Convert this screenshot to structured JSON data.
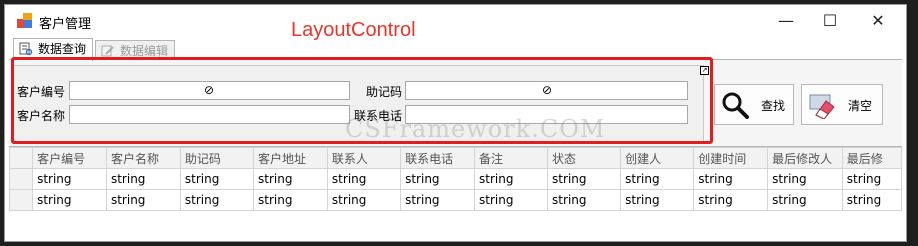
{
  "window": {
    "title": "客户管理",
    "minimize_glyph": "—",
    "maximize_glyph": "☐",
    "close_glyph": "✕"
  },
  "overlay_label": "LayoutControl",
  "tabs": [
    {
      "label": "数据查询",
      "active": true,
      "icon": "query-icon"
    },
    {
      "label": "数据编辑",
      "active": false,
      "icon": "edit-icon"
    }
  ],
  "search_form": {
    "customer_code_label": "客户编号",
    "customer_code_value": "",
    "mnemonic_label": "助记码",
    "mnemonic_value": "",
    "customer_name_label": "客户名称",
    "customer_name_value": "",
    "phone_label": "联系电话",
    "phone_value": "",
    "spin_glyph": "⊘",
    "corner_glyph": "↗"
  },
  "buttons": {
    "search_label": "查找",
    "clear_label": "清空"
  },
  "watermark": "CSFramework.COM",
  "grid": {
    "columns": [
      "客户编号",
      "客户名称",
      "助记码",
      "客户地址",
      "联系人",
      "联系电话",
      "备注",
      "状态",
      "创建人",
      "创建时间",
      "最后修改人",
      "最后修"
    ],
    "rows": [
      [
        "string",
        "string",
        "string",
        "string",
        "string",
        "string",
        "string",
        "string",
        "string",
        "string",
        "string",
        "string"
      ],
      [
        "string",
        "string",
        "string",
        "string",
        "string",
        "string",
        "string",
        "string",
        "string",
        "string",
        "string",
        "string"
      ]
    ]
  },
  "colors": {
    "accent_red": "#e11d1d",
    "overlay_text": "#e8352a"
  }
}
